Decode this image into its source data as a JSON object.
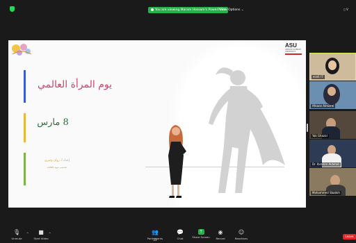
{
  "topbar": {
    "share_banner": "You are viewing Maram Hossam's PowerPoint",
    "view_options": "View Options ⌄",
    "view_button": "▯ V"
  },
  "slide": {
    "title": "يوم المرأة العالمي",
    "date": "8 مارس",
    "author": "إعداد أ. روان وجيري",
    "author_sub": "تصاميم تمهيد الطالبة",
    "logo_right": {
      "name": "ASU",
      "sub": "APPLIED SCIENCE UNIVERSITY"
    },
    "colors": {
      "bar1": "#3b5bd5",
      "bar2": "#e8b83c",
      "bar3": "#7fb24e",
      "title": "#c9456b",
      "date": "#2e6b3a"
    }
  },
  "participants": [
    {
      "name": "ecell.!7",
      "active": true
    },
    {
      "name": "Afnane Almizrei"
    },
    {
      "name": "Yak Ghazal"
    },
    {
      "name": "Dr. Ibrahim Aldehid"
    },
    {
      "name": "Mohammed Sbabkh"
    }
  ],
  "toolbar": {
    "unmute": "Unmute",
    "start_video": "Start Video",
    "participants": "Participants",
    "participants_count": "23",
    "chat": "Chat",
    "share_screen": "Share Screen",
    "record": "Record",
    "reactions": "Reactions",
    "leave": "Leave"
  }
}
